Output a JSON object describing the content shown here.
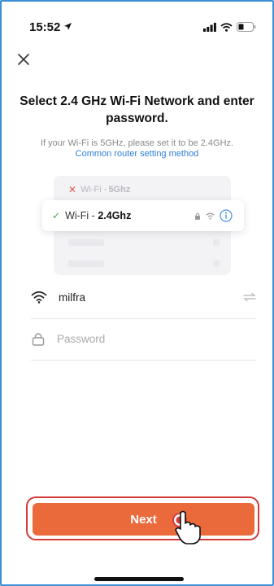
{
  "status_bar": {
    "time": "15:52"
  },
  "header": {
    "close_icon": "close-icon"
  },
  "main": {
    "title": "Select 2.4 GHz Wi-Fi Network and enter password.",
    "subtitle": "If your Wi-Fi is 5GHz, please set it to be 2.4GHz.",
    "router_link": "Common router setting method"
  },
  "illustration": {
    "row_5g_prefix": "Wi-Fi - ",
    "row_5g_band": "5Ghz",
    "row_24_prefix": "Wi-Fi - ",
    "row_24_band": "2.4Ghz"
  },
  "form": {
    "wifi_name": "milfra",
    "password_placeholder": "Password"
  },
  "footer": {
    "next_label": "Next"
  },
  "colors": {
    "accent": "#ea6a3b",
    "link": "#2f7fd8",
    "highlight": "#d33a3a"
  }
}
